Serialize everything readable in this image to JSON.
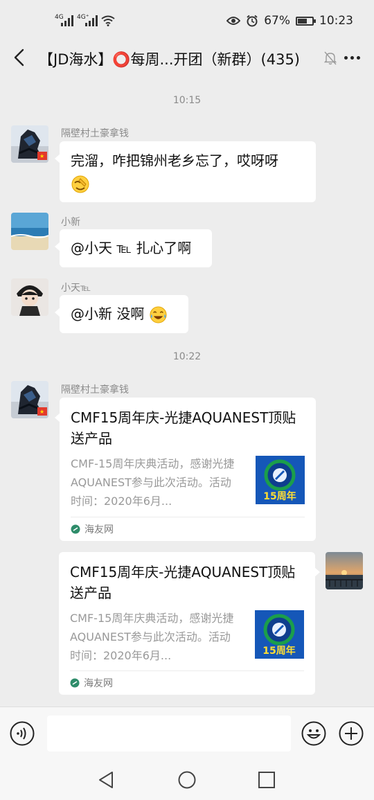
{
  "status_bar": {
    "signal1": "4G",
    "signal2": "4G⁺",
    "battery": "67%",
    "battery_level": 0.67,
    "time": "10:23"
  },
  "header": {
    "title": "【JD海水】⭕每周...开团（新群）(435)"
  },
  "timestamps": [
    "10:15",
    "10:22"
  ],
  "messages": [
    {
      "sender": "隔壁村土豪拿钱",
      "text": "完溜，咋把锦州老乡忘了，哎呀呀"
    },
    {
      "sender": "小新",
      "text": "@小天 ℡ 扎心了啊"
    },
    {
      "sender": "小天℡",
      "text": "@小新  没啊"
    }
  ],
  "cards": [
    {
      "sender": "隔壁村土豪拿钱",
      "title": "CMF15周年庆-光捷AQUANEST顶贴送产品",
      "desc": "CMF-15周年庆典活动，感谢光捷AQUANEST参与此次活动。活动时间：2020年6月...",
      "thumb_text": "15周年",
      "source": "海友网"
    },
    {
      "sender": "",
      "title": "CMF15周年庆-光捷AQUANEST顶贴送产品",
      "desc": "CMF-15周年庆典活动，感谢光捷AQUANEST参与此次活动。活动时间：2020年6月...",
      "thumb_text": "15周年",
      "source": "海友网"
    }
  ],
  "icons": {
    "back": "chevron-left-icon",
    "mute": "bell-muted-icon",
    "more": "more-dots-icon",
    "voice": "voice-icon",
    "emoji": "emoji-icon",
    "plus": "plus-icon"
  },
  "colors": {
    "background": "#ededed",
    "bubble": "#ffffff",
    "meta_text": "#8a8a8a"
  }
}
